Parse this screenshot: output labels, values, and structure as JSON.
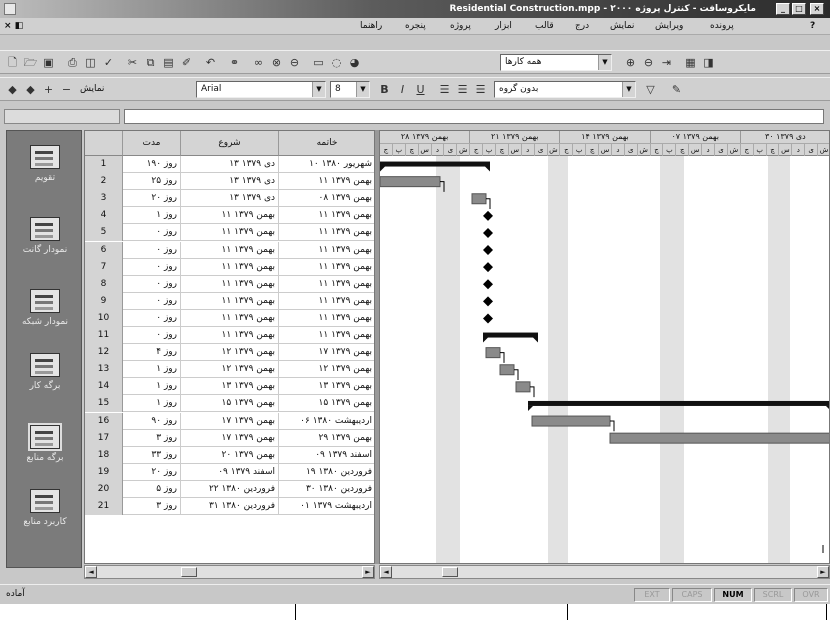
{
  "window": {
    "title": "Residential Construction.mpp - ۲۰۰۰ مایکروسافت - کنترل پروژه"
  },
  "menu": {
    "items": [
      "پرونده",
      "ویرایش",
      "نمایش",
      "درج",
      "قالب",
      "ابزار",
      "پروژه",
      "پنجره",
      "راهنما"
    ]
  },
  "toolbar": {
    "filter_value": "همه کارها",
    "font_name": "Arial",
    "font_size": "8",
    "group_value": "بدون گروه",
    "outline_label": "نمایش"
  },
  "views": [
    "تقویم",
    "نمودار گانت",
    "نمودار شبکه",
    "برگه کار",
    "برگه منابع",
    "کاربرد منابع"
  ],
  "table": {
    "headers": {
      "duration": "مدت",
      "start": "شروع",
      "finish": "خاتمه"
    },
    "rows": [
      {
        "id": "1",
        "duration": "۱۹۰ روز",
        "start": "۱۳ دی ۱۳۷۹",
        "finish": "۱۰ شهریور ۱۳۸۰"
      },
      {
        "id": "2",
        "duration": "۲۵ روز",
        "start": "۱۳ دی ۱۳۷۹",
        "finish": "۱۱ بهمن ۱۳۷۹"
      },
      {
        "id": "3",
        "duration": "۲۰ روز",
        "start": "۱۳ دی ۱۳۷۹",
        "finish": "۰۸ بهمن ۱۳۷۹"
      },
      {
        "id": "4",
        "duration": "۱ روز",
        "start": "۱۱ بهمن ۱۳۷۹",
        "finish": "۱۱ بهمن ۱۳۷۹"
      },
      {
        "id": "5",
        "duration": "۰ روز",
        "start": "۱۱ بهمن ۱۳۷۹",
        "finish": "۱۱ بهمن ۱۳۷۹"
      },
      {
        "id": "6",
        "duration": "۰ روز",
        "start": "۱۱ بهمن ۱۳۷۹",
        "finish": "۱۱ بهمن ۱۳۷۹"
      },
      {
        "id": "7",
        "duration": "۰ روز",
        "start": "۱۱ بهمن ۱۳۷۹",
        "finish": "۱۱ بهمن ۱۳۷۹"
      },
      {
        "id": "8",
        "duration": "۰ روز",
        "start": "۱۱ بهمن ۱۳۷۹",
        "finish": "۱۱ بهمن ۱۳۷۹"
      },
      {
        "id": "9",
        "duration": "۰ روز",
        "start": "۱۱ بهمن ۱۳۷۹",
        "finish": "۱۱ بهمن ۱۳۷۹"
      },
      {
        "id": "10",
        "duration": "۰ روز",
        "start": "۱۱ بهمن ۱۳۷۹",
        "finish": "۱۱ بهمن ۱۳۷۹"
      },
      {
        "id": "11",
        "duration": "۰ روز",
        "start": "۱۱ بهمن ۱۳۷۹",
        "finish": "۱۱ بهمن ۱۳۷۹"
      },
      {
        "id": "12",
        "duration": "۴ روز",
        "start": "۱۲ بهمن ۱۳۷۹",
        "finish": "۱۷ بهمن ۱۳۷۹"
      },
      {
        "id": "13",
        "duration": "۱ روز",
        "start": "۱۲ بهمن ۱۳۷۹",
        "finish": "۱۲ بهمن ۱۳۷۹"
      },
      {
        "id": "14",
        "duration": "۱ روز",
        "start": "۱۳ بهمن ۱۳۷۹",
        "finish": "۱۳ بهمن ۱۳۷۹"
      },
      {
        "id": "15",
        "duration": "۱ روز",
        "start": "۱۵ بهمن ۱۳۷۹",
        "finish": "۱۵ بهمن ۱۳۷۹"
      },
      {
        "id": "16",
        "duration": "۹۰ روز",
        "start": "۱۷ بهمن ۱۳۷۹",
        "finish": "۰۶ اردیبهشت ۱۳۸۰"
      },
      {
        "id": "17",
        "duration": "۳ روز",
        "start": "۱۷ بهمن ۱۳۷۹",
        "finish": "۲۹ بهمن ۱۳۷۹"
      },
      {
        "id": "18",
        "duration": "۳۳ روز",
        "start": "۲۰ بهمن ۱۳۷۹",
        "finish": "۰۹ اسفند ۱۳۷۹"
      },
      {
        "id": "19",
        "duration": "۲۰ روز",
        "start": "۰۹ اسفند ۱۳۷۹",
        "finish": "۱۹ فروردین ۱۳۸۰"
      },
      {
        "id": "20",
        "duration": "۵ روز",
        "start": "۲۲ فروردین ۱۳۸۰",
        "finish": "۳۰ فروردین ۱۳۸۰"
      },
      {
        "id": "21",
        "duration": "۳ روز",
        "start": "۳۱ فروردین ۱۳۸۰",
        "finish": "۰۱ اردیبهشت ۱۳۷۹"
      }
    ]
  },
  "timescale": {
    "major": [
      "۲۸ بهمن ۱۳۷۹",
      "۲۱ بهمن ۱۳۷۹",
      "۱۴ بهمن ۱۳۷۹",
      "۰۷ بهمن ۱۳۷۹",
      "۳۰ دی ۱۳۷۹"
    ],
    "minor": [
      "ج",
      "پ",
      "چ",
      "س",
      "د",
      "ی",
      "ش"
    ]
  },
  "gantt": {
    "bars": [
      {
        "row": 1,
        "type": "summary",
        "start": 0,
        "end": 110
      },
      {
        "row": 2,
        "type": "task",
        "start": 0,
        "end": 60
      },
      {
        "row": 3,
        "type": "task",
        "start": 92,
        "end": 106
      },
      {
        "row": 4,
        "type": "milestone",
        "at": 108
      },
      {
        "row": 5,
        "type": "milestone",
        "at": 108
      },
      {
        "row": 6,
        "type": "milestone",
        "at": 108
      },
      {
        "row": 7,
        "type": "milestone",
        "at": 108
      },
      {
        "row": 8,
        "type": "milestone",
        "at": 108
      },
      {
        "row": 9,
        "type": "milestone",
        "at": 108
      },
      {
        "row": 10,
        "type": "milestone",
        "at": 108
      },
      {
        "row": 11,
        "type": "summary",
        "start": 103,
        "end": 158
      },
      {
        "row": 12,
        "type": "task",
        "start": 106,
        "end": 120
      },
      {
        "row": 13,
        "type": "task",
        "start": 120,
        "end": 134
      },
      {
        "row": 14,
        "type": "task",
        "start": 136,
        "end": 150
      },
      {
        "row": 15,
        "type": "summary",
        "start": 148,
        "end": 451
      },
      {
        "row": 16,
        "type": "task",
        "start": 152,
        "end": 230
      },
      {
        "row": 17,
        "type": "task",
        "start": 230,
        "end": 451
      }
    ]
  },
  "status": {
    "mode": "آماده",
    "indicators": [
      "EXT",
      "CAPS",
      "NUM",
      "SCRL",
      "OVR"
    ],
    "active": [
      "NUM"
    ]
  },
  "colors": {
    "summary": "#111111",
    "task": "#8a8a8a",
    "nonworking": "#e2e2e2"
  }
}
